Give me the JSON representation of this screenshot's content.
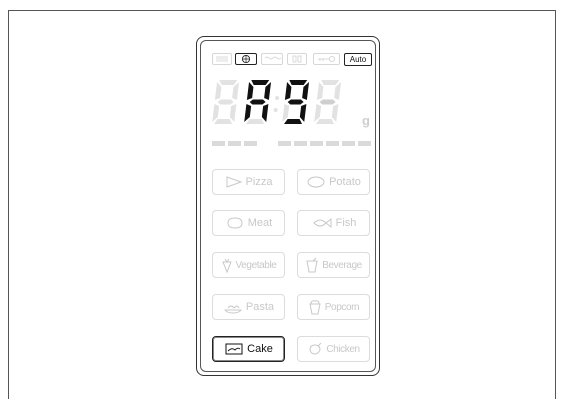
{
  "status_icons": [
    {
      "name": "grill-icon",
      "active": false
    },
    {
      "name": "convection-icon",
      "active": true
    },
    {
      "name": "heater-icon",
      "active": false
    },
    {
      "name": "child-lock-icon",
      "active": false
    },
    {
      "name": "key-icon",
      "active": false
    }
  ],
  "mode_badge": "Auto",
  "display": {
    "prefix": "A",
    "digits": "9",
    "suffix": "-",
    "unit": "g"
  },
  "buttons": [
    {
      "label": "Pizza",
      "icon": "pizza-icon",
      "active": false
    },
    {
      "label": "Potato",
      "icon": "potato-icon",
      "active": false
    },
    {
      "label": "Meat",
      "icon": "meat-icon",
      "active": false
    },
    {
      "label": "Fish",
      "icon": "fish-icon",
      "active": false
    },
    {
      "label": "Vegetable",
      "icon": "vegetable-icon",
      "active": false
    },
    {
      "label": "Beverage",
      "icon": "beverage-icon",
      "active": false
    },
    {
      "label": "Pasta",
      "icon": "pasta-icon",
      "active": false
    },
    {
      "label": "Popcorn",
      "icon": "popcorn-icon",
      "active": false
    },
    {
      "label": "Cake",
      "icon": "cake-icon",
      "active": true
    },
    {
      "label": "Chicken",
      "icon": "chicken-icon",
      "active": false
    }
  ],
  "colors": {
    "active": "#111111",
    "inactive": "#cfcfcf",
    "segment_off": "#e2e2e2"
  }
}
